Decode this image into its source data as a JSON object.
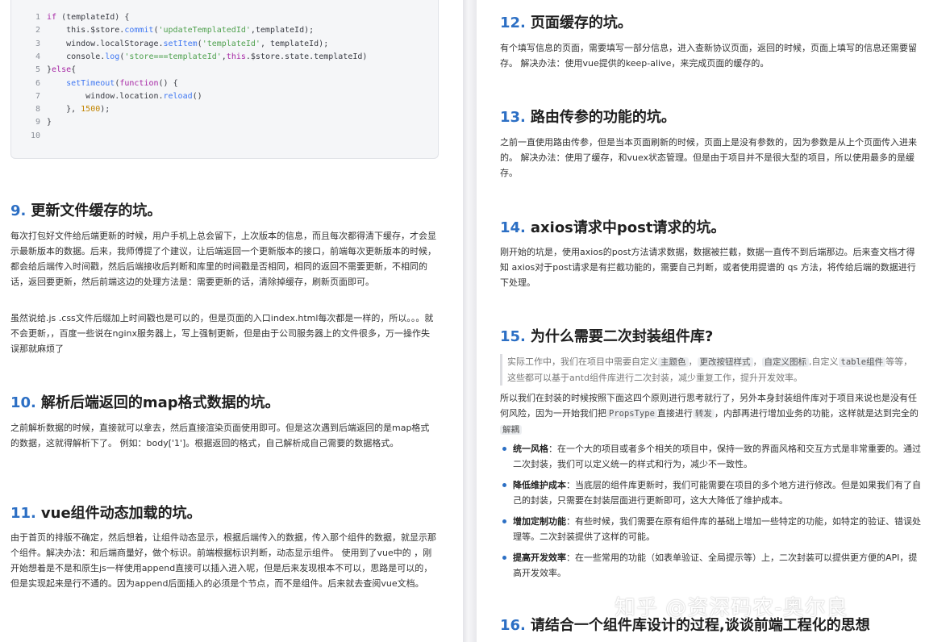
{
  "code": {
    "lines": [
      {
        "n": "1",
        "tokens": [
          [
            "kw",
            "if"
          ],
          [
            "txt",
            " (templateId) {"
          ]
        ]
      },
      {
        "n": "2",
        "tokens": [
          [
            "txt",
            "    this.$store."
          ],
          [
            "fn",
            "commit"
          ],
          [
            "txt",
            "("
          ],
          [
            "str",
            "'updateTemplatedId'"
          ],
          [
            "txt",
            ",templateId);"
          ]
        ]
      },
      {
        "n": "3",
        "tokens": [
          [
            "txt",
            "    window.localStorage."
          ],
          [
            "fn",
            "setItem"
          ],
          [
            "txt",
            "("
          ],
          [
            "str",
            "'templateId'"
          ],
          [
            "txt",
            ", templateId);"
          ]
        ]
      },
      {
        "n": "4",
        "tokens": [
          [
            "txt",
            "    console."
          ],
          [
            "fn",
            "log"
          ],
          [
            "txt",
            "("
          ],
          [
            "str",
            "'store===templateId'"
          ],
          [
            "txt",
            ","
          ],
          [
            "kw",
            "this"
          ],
          [
            "txt",
            ".$store.state.templateId)"
          ]
        ]
      },
      {
        "n": "5",
        "tokens": [
          [
            "txt",
            "}"
          ],
          [
            "kw",
            "else"
          ],
          [
            "txt",
            "{"
          ]
        ]
      },
      {
        "n": "6",
        "tokens": [
          [
            "txt",
            "    "
          ],
          [
            "fn",
            "setTimeout"
          ],
          [
            "txt",
            "("
          ],
          [
            "kw",
            "function"
          ],
          [
            "txt",
            "() {"
          ]
        ]
      },
      {
        "n": "7",
        "tokens": [
          [
            "txt",
            "        window.location."
          ],
          [
            "fn",
            "reload"
          ],
          [
            "txt",
            "()"
          ]
        ]
      },
      {
        "n": "8",
        "tokens": [
          [
            "txt",
            "    }, "
          ],
          [
            "num",
            "1500"
          ],
          [
            "txt",
            ");"
          ]
        ]
      },
      {
        "n": "9",
        "tokens": [
          [
            "txt",
            "}"
          ]
        ]
      },
      {
        "n": "10",
        "tokens": []
      }
    ]
  },
  "left": {
    "s9": {
      "num": "9.",
      "title": "更新文件缓存的坑。",
      "p1": "每次打包好文件给后端更新的时候，用户手机上总会留下，上次版本的信息，而且每次都得清下缓存，才会显示最新版本的数据。后来，我师傅提了个建议，让后端返回一个更新版本的接口，前端每次更新版本的时候，都会给后端传入时间戳，然后后端接收后判断和库里的时间戳是否相同，相同的返回不需要更新，不相同的话，返回要更新，然后前端这边的处理方法是：需要更新的话，清除掉缓存，刷新页面即可。",
      "p2": "虽然说给.js .css文件后缀加上时间戳也是可以的，但是页面的入口index.html每次都是一样的，所以。。。就不会更新，，百度一些说在nginx服务器上，写上强制更新，但是由于公司服务器上的文件很多，万一操作失误那就麻烦了"
    },
    "s10": {
      "num": "10.",
      "title": "解析后端返回的map格式数据的坑。",
      "p1": "之前解析数据的时候，直接就可以拿去，然后直接渲染页面使用即可。但是这次遇到后端返回的是map格式的数据，这就得解析下了。 例如：body['1']。根据返回的格式，自己解析成自己需要的数据格式。"
    },
    "s11": {
      "num": "11.",
      "title": "vue组件动态加载的坑。",
      "p1": "由于首页的排版不确定，然后想着，让组件动态显示，根据后端传入的数据，传入那个组件的数据，就显示那个组件。解决办法：和后端商量好，做个标识。前端根据标识判断，动态显示组件。 使用到了vue中的 ，刚开始想着是不是和原生js一样使用append直接可以插入进入呢，但是后来发现根本不可以，思路是可以的，但是实现起来是行不通的。因为append后面插入的必须是个节点，而不是组件。后来就去查阅vue文档。"
    }
  },
  "right": {
    "s12": {
      "num": "12.",
      "title": "页面缓存的坑。",
      "p1": "有个填写信息的页面，需要填写一部分信息，进入查新协议页面，返回的时候，页面上填写的信息还需要留存。 解决办法：使用vue提供的keep-alive，来完成页面的缓存的。"
    },
    "s13": {
      "num": "13.",
      "title": "路由传参的功能的坑。",
      "p1": "之前一直使用路由传参，但是当本页面刷新的时候，页面上是没有参数的，因为参数是从上个页面传入进来的。 解决办法：使用了缓存，和vuex状态管理。但是由于项目并不是很大型的项目，所以使用最多的是缓存。"
    },
    "s14": {
      "num": "14.",
      "title": "axios请求中post请求的坑。",
      "p1": "刚开始的坑是，使用axios的post方法请求数据，数据被拦截，数据一直传不到后端那边。后来查文档才得知 axios对于post请求是有拦截功能的，需要自己判断，或者使用提谱的 qs 方法，将传给后端的数据进行下处理。"
    },
    "s15": {
      "num": "15.",
      "title": "为什么需要二次封装组件库?",
      "quote": {
        "t1": "实际工作中，我们在项目中需要自定义",
        "c1": "主题色",
        "t2": "，",
        "c2": "更改按钮样式",
        "t3": "，",
        "c3": "自定义图标",
        "t4": ",自定义",
        "c4": "table组件",
        "t5": "等等，这些都可以基于antd组件库进行二次封装，减少重复工作，提升开发效率。"
      },
      "p1a": "所以我们在封装的时候按照下面这四个原则进行思考就行了，另外本身封装组件库对于项目来说也是没有任何风险，因为一开始我们把",
      "p1c1": "PropsType",
      "p1b": "直接进行",
      "p1c2": "转发",
      "p1c": "，内部再进行增加业务的功能，这样就是达到完全的",
      "p1c3": "解耦",
      "items": [
        {
          "label": "统一风格",
          "text": "：在一个大的项目或者多个相关的项目中，保持一致的界面风格和交互方式是非常重要的。通过二次封装，我们可以定义统一的样式和行为，减少不一致性。"
        },
        {
          "label": "降低维护成本",
          "text": "：当底层的组件库更新时，我们可能需要在项目的多个地方进行修改。但是如果我们有了自己的封装，只需要在封装层面进行更新即可，这大大降低了维护成本。"
        },
        {
          "label": "增加定制功能",
          "text": "：有些时候，我们需要在原有组件库的基础上增加一些特定的功能，如特定的验证、错误处理等。二次封装提供了这样的可能。"
        },
        {
          "label": "提高开发效率",
          "text": "：在一些常用的功能（如表单验证、全局提示等）上，二次封装可以提供更方便的API，提高开发效率。"
        }
      ]
    },
    "s16": {
      "num": "16.",
      "title": "请结合一个组件库设计的过程,谈谈前端工程化的思想"
    }
  },
  "watermark": "知乎 @资深码农-奥尔良"
}
